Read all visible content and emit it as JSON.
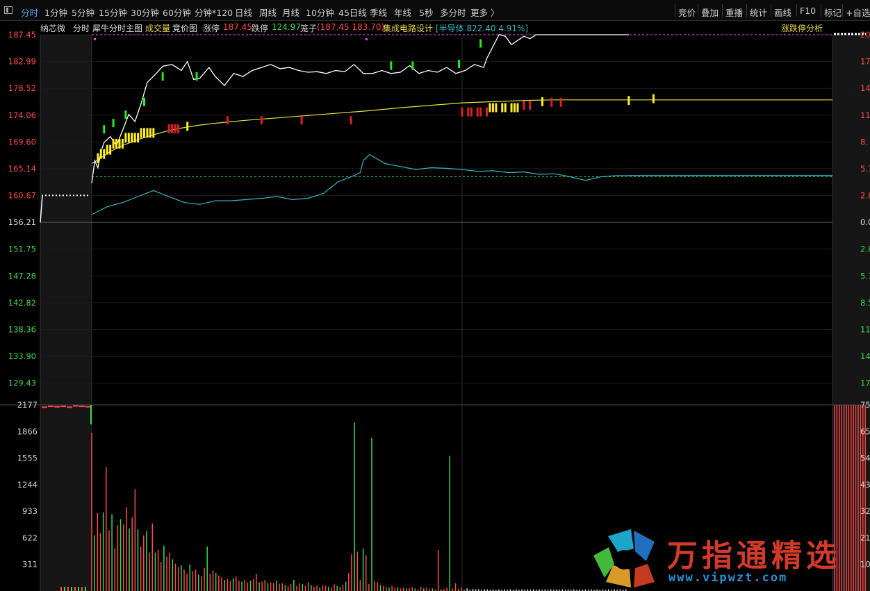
{
  "toolbar": {
    "tabs": [
      {
        "label": "分时",
        "active": true
      },
      {
        "label": "1分钟"
      },
      {
        "label": "5分钟"
      },
      {
        "label": "15分钟"
      },
      {
        "label": "30分钟"
      },
      {
        "label": "60分钟"
      },
      {
        "label": "分钟*120"
      },
      {
        "label": "日线"
      },
      {
        "label": "周线"
      },
      {
        "label": "月线"
      },
      {
        "label": "10分钟"
      },
      {
        "label": "45日线"
      },
      {
        "label": "季线"
      },
      {
        "label": "年线"
      },
      {
        "label": "5秒"
      },
      {
        "label": "多分时"
      },
      {
        "label": "更多 〉"
      }
    ],
    "right_tabs": [
      "竞价",
      "叠加",
      "重播",
      "统计",
      "画线",
      "F10",
      "标记",
      "+自选"
    ]
  },
  "info": {
    "stock_name": "纳芯微",
    "mode": "分时",
    "indicator": "犀牛分时主图",
    "volume_label": "成交量",
    "auction_label": "竞价图",
    "limit_up_label": "涨停",
    "limit_up_value": "187.45",
    "limit_down_label": "跌停",
    "limit_down_value": "124.97",
    "cage_label": "笼子",
    "cage_value": "(187.45 183.70)",
    "sector_label": "集成电路设计",
    "industry_text": "[半导体 822.40 4.91%]",
    "analysis_button": "涨跌停分析",
    "close_symbol": "×"
  },
  "colors": {
    "up": "#ff4a4a",
    "down": "#3fd94c",
    "price_line": "#ffffff",
    "avg_line": "#e8e23a",
    "index_line": "#3bb5c8",
    "limit_line": "#ff40ff",
    "ref_line": "#22cc44",
    "signal_yellow": "#ffee22",
    "signal_red": "#e02020",
    "signal_green": "#22ee22"
  },
  "chart_data": {
    "type": "line",
    "price_axis_labels": [
      "187.45",
      "182.99",
      "178.52",
      "174.06",
      "169.60",
      "165.14",
      "160.67",
      "156.21",
      "151.75",
      "147.28",
      "142.82",
      "138.36",
      "133.90",
      "129.43"
    ],
    "pct_axis_labels": [
      "20",
      "17",
      "14",
      "11",
      "8.",
      "5.7",
      "2.8",
      "0.0",
      "2.8",
      "5.7",
      "8.5",
      "11",
      "14",
      "17"
    ],
    "volume_axis_labels": [
      "2177",
      "1866",
      "1555",
      "1244",
      "933",
      "622",
      "311"
    ],
    "volume_pct_labels": [
      "75",
      "65",
      "54",
      "43",
      "32",
      "21",
      "10"
    ],
    "y_range": [
      127.2,
      187.45
    ],
    "prev_close": 156.21,
    "auction_price": 160.7,
    "ref_level": 163.8,
    "price": {
      "x": [
        0,
        1,
        2,
        3,
        4,
        6,
        8,
        10,
        12,
        14,
        16,
        18,
        20,
        23,
        26,
        29,
        31,
        33,
        35,
        38,
        40,
        43,
        46,
        49,
        52,
        55,
        58,
        61,
        64,
        67,
        70,
        73,
        76,
        79,
        82,
        85,
        88,
        91,
        94,
        97,
        100,
        103,
        106,
        109,
        112,
        115,
        118,
        121,
        124,
        127,
        128,
        130,
        132,
        134,
        136,
        138,
        140,
        142,
        144,
        146,
        148,
        150,
        152,
        154,
        156,
        158,
        160,
        162,
        164,
        166,
        168,
        170,
        172,
        174
      ],
      "y": [
        162.7,
        166.5,
        165.3,
        168.0,
        169.5,
        170.5,
        169.0,
        171.5,
        174.2,
        173.0,
        176.0,
        179.5,
        180.5,
        182.2,
        182.5,
        181.5,
        183.0,
        180.0,
        180.2,
        182.0,
        180.5,
        179.0,
        181.0,
        180.5,
        181.5,
        182.0,
        182.5,
        181.8,
        182.0,
        181.5,
        181.2,
        181.3,
        181.0,
        181.5,
        181.3,
        182.5,
        181.0,
        181.0,
        181.5,
        181.0,
        181.2,
        182.3,
        181.0,
        181.5,
        181.2,
        182.0,
        181.0,
        181.5,
        182.5,
        182.0,
        183.5,
        185.5,
        187.5,
        187.2,
        185.8,
        186.5,
        187.2,
        186.8,
        187.45,
        187.45,
        187.45,
        187.45,
        187.45,
        187.45,
        187.45,
        187.45,
        187.45,
        187.45,
        187.45,
        187.45,
        187.45,
        187.45,
        187.45,
        187.45
      ]
    },
    "avg": {
      "x": [
        0,
        2,
        4,
        6,
        10,
        15,
        20,
        25,
        30,
        35,
        40,
        50,
        60,
        70,
        80,
        90,
        100,
        110,
        120,
        130,
        140,
        150,
        160,
        170,
        174
      ],
      "y": [
        166.0,
        166.6,
        167.3,
        168.0,
        169.0,
        170.0,
        170.8,
        171.5,
        172.0,
        172.4,
        172.7,
        173.2,
        173.6,
        174.0,
        174.4,
        174.8,
        175.3,
        175.7,
        176.1,
        176.3,
        176.5,
        176.6,
        176.6,
        176.6,
        176.6
      ]
    },
    "index": {
      "x": [
        0,
        5,
        10,
        15,
        20,
        25,
        30,
        35,
        40,
        45,
        50,
        55,
        60,
        65,
        70,
        75,
        80,
        85,
        87,
        88,
        90,
        95,
        100,
        105,
        110,
        115,
        120,
        125,
        130,
        135,
        140,
        145,
        150,
        155,
        160,
        165,
        170,
        174
      ],
      "y": [
        157.5,
        158.8,
        159.5,
        160.5,
        161.5,
        160.5,
        159.5,
        159.2,
        159.8,
        159.8,
        160.0,
        160.2,
        160.5,
        160.0,
        160.2,
        161.0,
        163.0,
        164.0,
        164.5,
        166.5,
        167.5,
        166.0,
        165.5,
        165.0,
        165.3,
        165.2,
        165.0,
        164.7,
        164.8,
        164.5,
        164.6,
        164.2,
        164.3,
        163.8,
        163.2,
        163.8,
        164.0,
        164.0
      ]
    },
    "auction_vol": [
      2150,
      2160,
      2155,
      2160,
      2150,
      2165,
      2160,
      2155
    ],
    "volume": {
      "values": [
        1850,
        650,
        910,
        680,
        920,
        1450,
        710,
        900,
        500,
        770,
        840,
        780,
        980,
        730,
        860,
        1190,
        720,
        520,
        650,
        700,
        450,
        790,
        450,
        480,
        340,
        530,
        400,
        450,
        370,
        320,
        280,
        300,
        250,
        200,
        310,
        230,
        250,
        190,
        170,
        270,
        520,
        200,
        240,
        210,
        180,
        160,
        130,
        140,
        120,
        150,
        170,
        120,
        110,
        130,
        100,
        120,
        140,
        200,
        100,
        110,
        130,
        90,
        100,
        95,
        120,
        85,
        90,
        70,
        60,
        80,
        130,
        60,
        90,
        80,
        60,
        100,
        70,
        50,
        60,
        40,
        70,
        60,
        50,
        40,
        80,
        60,
        50,
        70,
        110,
        210,
        430,
        1970,
        460,
        130,
        500,
        420,
        80,
        1790,
        120,
        100,
        70,
        60,
        50,
        40,
        60,
        40,
        45,
        30,
        40,
        30,
        35,
        45,
        30,
        20,
        50,
        30,
        40,
        25,
        30,
        20,
        480,
        20,
        25,
        40,
        1580,
        30,
        90,
        25,
        40,
        20,
        30,
        15,
        25,
        20,
        20,
        15,
        20,
        20,
        15,
        20,
        15,
        20,
        15,
        20,
        15,
        20,
        15,
        20,
        15,
        20,
        15,
        20,
        15,
        20,
        15,
        20,
        15,
        20,
        15,
        20,
        15,
        20,
        15,
        20,
        15,
        20,
        15,
        20,
        15,
        20,
        15,
        20,
        15,
        20,
        15,
        20,
        15,
        20,
        15,
        20,
        15,
        20,
        15,
        20,
        15,
        20
      ]
    },
    "closing_vol": [
      2177,
      2177,
      2177,
      2177,
      2177,
      2177,
      2177,
      2177
    ]
  },
  "watermark": {
    "title": "万指通精选",
    "url": "www.vipwzt.com"
  }
}
